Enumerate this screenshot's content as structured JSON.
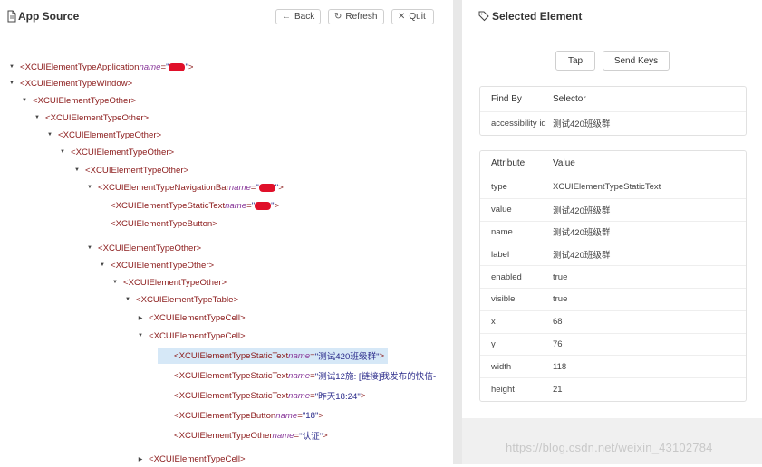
{
  "left_panel": {
    "title": "App Source",
    "back_label": "Back",
    "refresh_label": "Refresh",
    "quit_label": "Quit"
  },
  "tree": [
    {
      "tag": "<XCUIElementTypeApplication",
      "attr": "name",
      "val": "\"",
      "redact": true,
      "close": ">",
      "toggle": "open"
    },
    {
      "tag": "<XCUIElementTypeWindow>",
      "toggle": "open"
    },
    {
      "tag": "<XCUIElementTypeOther>",
      "toggle": "open"
    },
    {
      "tag": "<XCUIElementTypeOther>",
      "toggle": "open"
    },
    {
      "tag": "<XCUIElementTypeOther>",
      "toggle": "open"
    },
    {
      "tag": "<XCUIElementTypeOther>",
      "toggle": "open"
    },
    {
      "tag": "<XCUIElementTypeOther>",
      "toggle": "open"
    },
    {
      "tag": "<XCUIElementTypeNavigationBar",
      "attr": "name",
      "val": "\"",
      "redact": true,
      "close": ">",
      "toggle": "open"
    },
    {
      "tag": "<XCUIElementTypeStaticText",
      "attr": "name",
      "val": "\"",
      "redact": true,
      "close": ">",
      "toggle": "none"
    },
    {
      "tag": "<XCUIElementTypeButton>",
      "toggle": "none"
    },
    {
      "tag": "<XCUIElementTypeOther>",
      "toggle": "open"
    },
    {
      "tag": "<XCUIElementTypeOther>",
      "toggle": "open"
    },
    {
      "tag": "<XCUIElementTypeOther>",
      "toggle": "open"
    },
    {
      "tag": "<XCUIElementTypeTable>",
      "toggle": "open"
    },
    {
      "tag": "<XCUIElementTypeCell>",
      "toggle": "closed"
    },
    {
      "tag": "<XCUIElementTypeCell>",
      "toggle": "open"
    },
    {
      "tag": "<XCUIElementTypeStaticText",
      "attr": "name",
      "val": "\"测试420班级群\"",
      "close": ">",
      "toggle": "none",
      "selected": true
    },
    {
      "tag": "<XCUIElementTypeStaticText",
      "attr": "name",
      "val": "\"测试12施: [链接]我发布的快信-",
      "close": "",
      "toggle": "none"
    },
    {
      "tag": "<XCUIElementTypeStaticText",
      "attr": "name",
      "val": "\"昨天18:24\"",
      "close": ">",
      "toggle": "none"
    },
    {
      "tag": "<XCUIElementTypeButton",
      "attr": "name",
      "val": "\"18\"",
      "close": ">",
      "toggle": "none"
    },
    {
      "tag": "<XCUIElementTypeOther",
      "attr": "name",
      "val": "\"认证\"",
      "close": ">",
      "toggle": "none"
    },
    {
      "tag": "<XCUIElementTypeCell>",
      "toggle": "closed"
    }
  ],
  "right_panel": {
    "title": "Selected Element",
    "tap_label": "Tap",
    "send_keys_label": "Send Keys",
    "find_by": {
      "headers": [
        "Find By",
        "Selector"
      ],
      "rows": [
        [
          "accessibility id",
          "测试420班级群"
        ]
      ]
    },
    "attributes": {
      "headers": [
        "Attribute",
        "Value"
      ],
      "rows": [
        [
          "type",
          "XCUIElementTypeStaticText"
        ],
        [
          "value",
          "测试420班级群"
        ],
        [
          "name",
          "测试420班级群"
        ],
        [
          "label",
          "测试420班级群"
        ],
        [
          "enabled",
          "true"
        ],
        [
          "visible",
          "true"
        ],
        [
          "x",
          "68"
        ],
        [
          "y",
          "76"
        ],
        [
          "width",
          "118"
        ],
        [
          "height",
          "21"
        ]
      ]
    }
  },
  "watermark": "https://blog.csdn.net/weixin_43102784"
}
